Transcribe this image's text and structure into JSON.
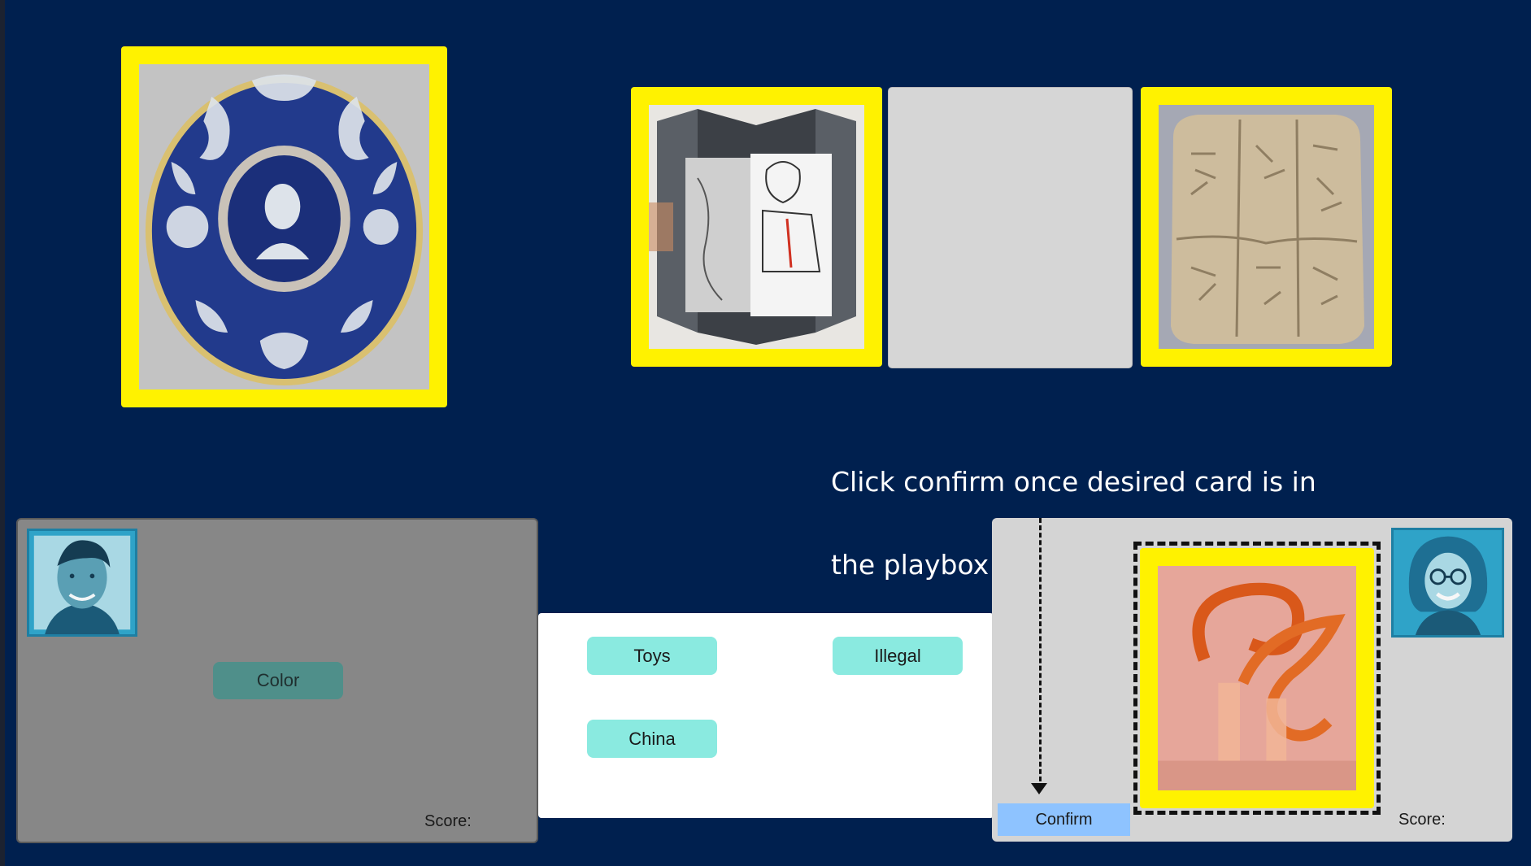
{
  "instruction": {
    "line1": "Click confirm once desired card is in",
    "line2": "the playbox to finalize your guess"
  },
  "player_left": {
    "avatar_icon": "man-portrait-avatar",
    "clue_label": "Color",
    "score_label": "Score:"
  },
  "player_right": {
    "avatar_icon": "woman-glasses-portrait-avatar",
    "score_label": "Score:",
    "confirm_label": "Confirm"
  },
  "word_bank": [
    "Toys",
    "Illegal",
    "China"
  ],
  "cards": {
    "featured": "blue-decorated-plate",
    "row": [
      "pop-up-book",
      "empty-slot",
      "cuneiform-tablet"
    ],
    "playbox": "orange-glass-sculpture"
  },
  "colors": {
    "background": "#00204f",
    "card_border": "#fff200",
    "word_button": "#8aeae0",
    "clue_button": "#4f8f8a",
    "confirm_button": "#8ec3ff"
  }
}
